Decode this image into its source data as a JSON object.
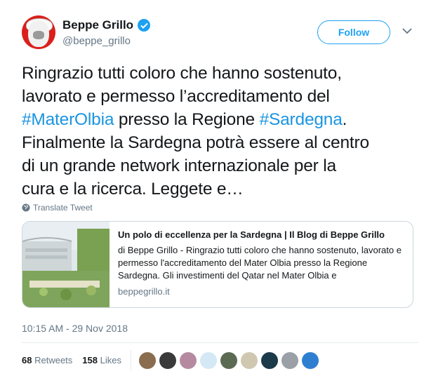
{
  "author": {
    "display_name": "Beppe Grillo",
    "handle": "@beppe_grillo",
    "verified_icon": "verified-badge-icon"
  },
  "actions": {
    "follow_label": "Follow",
    "menu_icon": "chevron-down-icon"
  },
  "tweet": {
    "line1": "Ringrazio tutti coloro che hanno sostenuto,",
    "line2": "lavorato e permesso l’accreditamento del",
    "hashtag1": "#MaterOlbia",
    "mid": " presso la Regione ",
    "hashtag2": "#Sardegna",
    "dot": ".",
    "line4": "Finalmente la Sardegna potrà essere al centro",
    "line5": "di un grande network internazionale per la",
    "line6": "cura e la ricerca. Leggete e…"
  },
  "translate_label": "Translate Tweet",
  "card": {
    "title": "Un polo di eccellenza per la Sardegna | Il Blog di Beppe Grillo",
    "description": "di Beppe Grillo - Ringrazio tutti coloro che hanno sostenuto, lavorato e permesso l'accreditamento del Mater Olbia presso la Regione Sardegna. Gli investimenti del Qatar nel Mater Olbia e",
    "domain": "beppegrillo.it"
  },
  "timestamp": "10:15 AM - 29 Nov 2018",
  "stats": {
    "retweets_count": "68",
    "retweets_label": "Retweets",
    "likes_count": "158",
    "likes_label": "Likes"
  },
  "colors": {
    "accent": "#1da1f2",
    "hashtag": "#1b95e0",
    "muted": "#657786",
    "text": "#14171a"
  },
  "likers": [
    {
      "color": "#8a6d4e"
    },
    {
      "color": "#3a3a3a"
    },
    {
      "color": "#b58aa0"
    },
    {
      "color": "#d5e8f5"
    },
    {
      "color": "#5b6b53"
    },
    {
      "color": "#cfc7b0"
    },
    {
      "color": "#1b3a4a"
    },
    {
      "color": "#9aa0a6"
    },
    {
      "color": "#2f7fd0"
    }
  ]
}
